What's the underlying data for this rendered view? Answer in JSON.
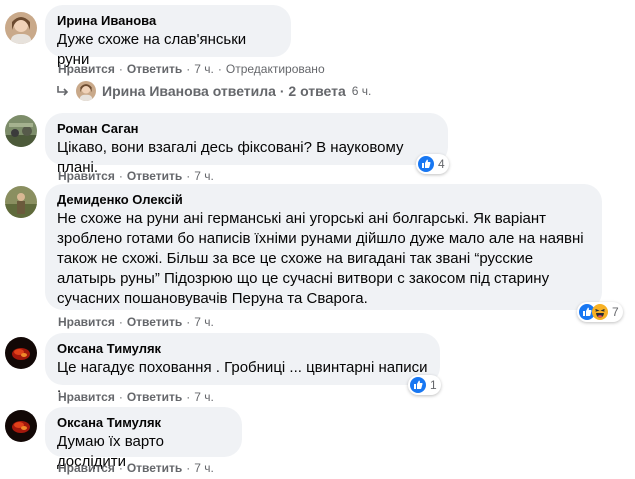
{
  "comments": [
    {
      "author": "Ирина Иванова",
      "text": "Дуже схоже на слав'янськи руни",
      "actions": {
        "like": "Нравится",
        "reply": "Ответить",
        "time": "7 ч.",
        "edited": "Отредактировано"
      }
    },
    {
      "author": "Роман Саган",
      "text": "Цікаво, вони взагалі десь фіксовані? В науковому плані.",
      "actions": {
        "like": "Нравится",
        "reply": "Ответить",
        "time": "7 ч."
      },
      "reactions": {
        "count": "4",
        "icons": [
          "like-reaction-icon"
        ]
      }
    },
    {
      "author": "Демиденко Олексій",
      "text": "Не схоже на руни ані германські ані угорські ані болгарські. Як варіант зроблено готами бо написів їхніми рунами дійшло дуже мало але на наявні також не схожі. Більш за все це схоже на вигадані так звані “русские алатырь руны” Підозрюю що це сучасні витвори с закосом під старину сучасних пошановувачів Перуна та Сварога.",
      "actions": {
        "like": "Нравится",
        "reply": "Ответить",
        "time": "7 ч."
      },
      "reactions": {
        "count": "7",
        "icons": [
          "like-reaction-icon",
          "haha-reaction-icon"
        ]
      }
    },
    {
      "author": "Оксана Тимуляк",
      "text": "Це нагадує поховання . Гробниці ... цвинтарні написи .",
      "actions": {
        "like": "Нравится",
        "reply": "Ответить",
        "time": "7 ч."
      },
      "reactions": {
        "count": "1",
        "icons": [
          "like-reaction-icon"
        ]
      }
    },
    {
      "author": "Оксана Тимуляк",
      "text": "Думаю їх варто дослідити",
      "actions": {
        "like": "Нравится",
        "reply": "Ответить",
        "time": "7 ч."
      }
    }
  ],
  "replies_link": {
    "text": "Ирина Иванова ответила · 2 ответа",
    "time": "6 ч."
  },
  "separator": "·",
  "colors": {
    "bubble": "#f0f2f5",
    "secondary_text": "#65676b",
    "like_blue": "#1877f2",
    "haha_yellow": "#f7b125"
  }
}
